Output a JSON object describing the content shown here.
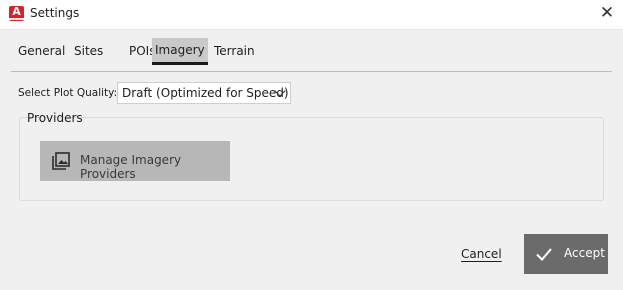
{
  "window": {
    "title": "Settings",
    "app_icon_letter": "A",
    "close_symbol": "✕"
  },
  "tabs": [
    {
      "label": "General",
      "active": false
    },
    {
      "label": "Sites",
      "active": false
    },
    {
      "label": "POIs",
      "active": false
    },
    {
      "label": "Imagery",
      "active": true
    },
    {
      "label": "Terrain",
      "active": false
    }
  ],
  "imagery": {
    "plot_quality_label": "Select Plot Quality:",
    "plot_quality_value": "Draft (Optimized for Speed)",
    "providers_group_label": "Providers",
    "manage_button_label": "Manage Imagery Providers"
  },
  "footer": {
    "cancel_label": "Cancel",
    "accept_label": "Accept"
  },
  "colors": {
    "app_icon": "#d3232f",
    "accept_bg": "#6b6b6b",
    "manage_bg": "#b7b7b7",
    "active_tab_bg": "#c9c9c9"
  },
  "icons": {
    "app": "autodesk-app-icon",
    "close": "close-icon",
    "dropdown": "chevron-down-icon",
    "manage": "image-stack-icon",
    "accept": "checkmark-icon"
  }
}
